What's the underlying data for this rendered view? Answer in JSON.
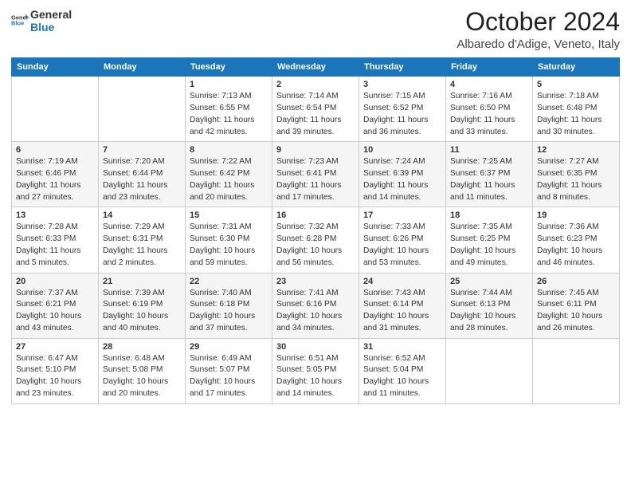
{
  "logo": {
    "line1": "General",
    "line2": "Blue"
  },
  "title": "October 2024",
  "subtitle": "Albaredo d'Adige, Veneto, Italy",
  "columns": [
    "Sunday",
    "Monday",
    "Tuesday",
    "Wednesday",
    "Thursday",
    "Friday",
    "Saturday"
  ],
  "weeks": [
    [
      {
        "day": "",
        "content": ""
      },
      {
        "day": "",
        "content": ""
      },
      {
        "day": "1",
        "content": "Sunrise: 7:13 AM\nSunset: 6:55 PM\nDaylight: 11 hours and 42 minutes."
      },
      {
        "day": "2",
        "content": "Sunrise: 7:14 AM\nSunset: 6:54 PM\nDaylight: 11 hours and 39 minutes."
      },
      {
        "day": "3",
        "content": "Sunrise: 7:15 AM\nSunset: 6:52 PM\nDaylight: 11 hours and 36 minutes."
      },
      {
        "day": "4",
        "content": "Sunrise: 7:16 AM\nSunset: 6:50 PM\nDaylight: 11 hours and 33 minutes."
      },
      {
        "day": "5",
        "content": "Sunrise: 7:18 AM\nSunset: 6:48 PM\nDaylight: 11 hours and 30 minutes."
      }
    ],
    [
      {
        "day": "6",
        "content": "Sunrise: 7:19 AM\nSunset: 6:46 PM\nDaylight: 11 hours and 27 minutes."
      },
      {
        "day": "7",
        "content": "Sunrise: 7:20 AM\nSunset: 6:44 PM\nDaylight: 11 hours and 23 minutes."
      },
      {
        "day": "8",
        "content": "Sunrise: 7:22 AM\nSunset: 6:42 PM\nDaylight: 11 hours and 20 minutes."
      },
      {
        "day": "9",
        "content": "Sunrise: 7:23 AM\nSunset: 6:41 PM\nDaylight: 11 hours and 17 minutes."
      },
      {
        "day": "10",
        "content": "Sunrise: 7:24 AM\nSunset: 6:39 PM\nDaylight: 11 hours and 14 minutes."
      },
      {
        "day": "11",
        "content": "Sunrise: 7:25 AM\nSunset: 6:37 PM\nDaylight: 11 hours and 11 minutes."
      },
      {
        "day": "12",
        "content": "Sunrise: 7:27 AM\nSunset: 6:35 PM\nDaylight: 11 hours and 8 minutes."
      }
    ],
    [
      {
        "day": "13",
        "content": "Sunrise: 7:28 AM\nSunset: 6:33 PM\nDaylight: 11 hours and 5 minutes."
      },
      {
        "day": "14",
        "content": "Sunrise: 7:29 AM\nSunset: 6:31 PM\nDaylight: 11 hours and 2 minutes."
      },
      {
        "day": "15",
        "content": "Sunrise: 7:31 AM\nSunset: 6:30 PM\nDaylight: 10 hours and 59 minutes."
      },
      {
        "day": "16",
        "content": "Sunrise: 7:32 AM\nSunset: 6:28 PM\nDaylight: 10 hours and 56 minutes."
      },
      {
        "day": "17",
        "content": "Sunrise: 7:33 AM\nSunset: 6:26 PM\nDaylight: 10 hours and 53 minutes."
      },
      {
        "day": "18",
        "content": "Sunrise: 7:35 AM\nSunset: 6:25 PM\nDaylight: 10 hours and 49 minutes."
      },
      {
        "day": "19",
        "content": "Sunrise: 7:36 AM\nSunset: 6:23 PM\nDaylight: 10 hours and 46 minutes."
      }
    ],
    [
      {
        "day": "20",
        "content": "Sunrise: 7:37 AM\nSunset: 6:21 PM\nDaylight: 10 hours and 43 minutes."
      },
      {
        "day": "21",
        "content": "Sunrise: 7:39 AM\nSunset: 6:19 PM\nDaylight: 10 hours and 40 minutes."
      },
      {
        "day": "22",
        "content": "Sunrise: 7:40 AM\nSunset: 6:18 PM\nDaylight: 10 hours and 37 minutes."
      },
      {
        "day": "23",
        "content": "Sunrise: 7:41 AM\nSunset: 6:16 PM\nDaylight: 10 hours and 34 minutes."
      },
      {
        "day": "24",
        "content": "Sunrise: 7:43 AM\nSunset: 6:14 PM\nDaylight: 10 hours and 31 minutes."
      },
      {
        "day": "25",
        "content": "Sunrise: 7:44 AM\nSunset: 6:13 PM\nDaylight: 10 hours and 28 minutes."
      },
      {
        "day": "26",
        "content": "Sunrise: 7:45 AM\nSunset: 6:11 PM\nDaylight: 10 hours and 26 minutes."
      }
    ],
    [
      {
        "day": "27",
        "content": "Sunrise: 6:47 AM\nSunset: 5:10 PM\nDaylight: 10 hours and 23 minutes."
      },
      {
        "day": "28",
        "content": "Sunrise: 6:48 AM\nSunset: 5:08 PM\nDaylight: 10 hours and 20 minutes."
      },
      {
        "day": "29",
        "content": "Sunrise: 6:49 AM\nSunset: 5:07 PM\nDaylight: 10 hours and 17 minutes."
      },
      {
        "day": "30",
        "content": "Sunrise: 6:51 AM\nSunset: 5:05 PM\nDaylight: 10 hours and 14 minutes."
      },
      {
        "day": "31",
        "content": "Sunrise: 6:52 AM\nSunset: 5:04 PM\nDaylight: 10 hours and 11 minutes."
      },
      {
        "day": "",
        "content": ""
      },
      {
        "day": "",
        "content": ""
      }
    ]
  ]
}
